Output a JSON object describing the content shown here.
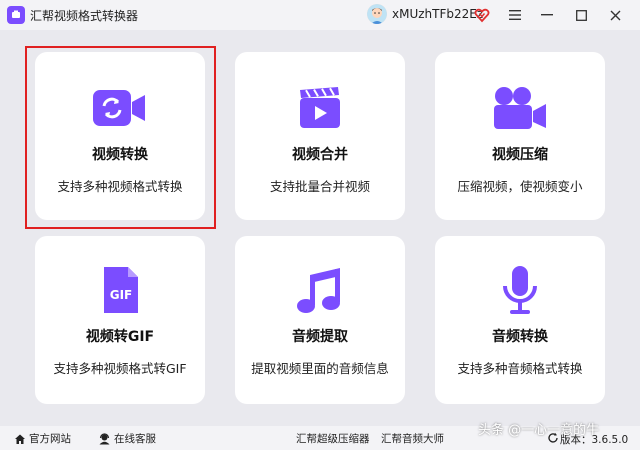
{
  "app": {
    "title": "汇帮视频格式转换器",
    "accent": "#7b4dff"
  },
  "user": {
    "name": "xMUzhTFb22Ez"
  },
  "cards": [
    {
      "title": "视频转换",
      "desc": "支持多种视频格式转换",
      "icon": "video-convert-icon"
    },
    {
      "title": "视频合并",
      "desc": "支持批量合并视频",
      "icon": "video-merge-icon"
    },
    {
      "title": "视频压缩",
      "desc": "压缩视频，使视频变小",
      "icon": "video-compress-icon"
    },
    {
      "title": "视频转GIF",
      "desc": "支持多种视频格式转GIF",
      "icon": "gif-icon"
    },
    {
      "title": "音频提取",
      "desc": "提取视频里面的音频信息",
      "icon": "music-note-icon"
    },
    {
      "title": "音频转换",
      "desc": "支持多种音频格式转换",
      "icon": "microphone-icon"
    }
  ],
  "footer": {
    "website": "官方网站",
    "support": "在线客服",
    "compressor": "汇帮超级压缩器",
    "audio_master": "汇帮音频大师",
    "version": "版本：3.6.5.0"
  },
  "watermark": "头条 @一心一意的牛"
}
